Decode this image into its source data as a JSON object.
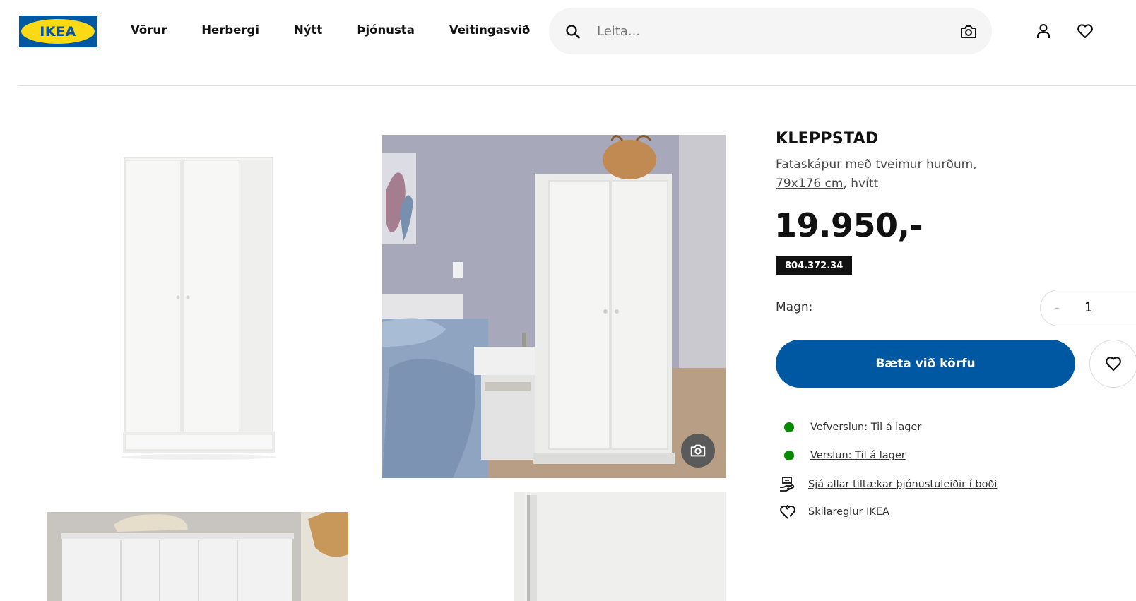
{
  "header": {
    "logo_text": "IKEA",
    "nav": [
      "Vörur",
      "Herbergi",
      "Nýtt",
      "Þjónusta",
      "Veitingasvið"
    ],
    "search_placeholder": "Leita...",
    "icons": [
      "search-icon",
      "camera-icon",
      "user-icon",
      "heart-icon"
    ]
  },
  "product": {
    "name": "KLEPPSTAD",
    "description_line1": "Fataskápur með tveimur hurðum,",
    "measure": "79x176 cm",
    "color_suffix": ", hvítt",
    "price": "19.950,-",
    "article_number": "804.372.34",
    "quantity_label": "Magn:",
    "quantity_minus": "-",
    "quantity_value": "1",
    "add_to_cart": "Bæta við körfu"
  },
  "availability": {
    "online": "Vefverslun: Til á lager",
    "store": "Verslun: Til á lager",
    "services_link": "Sjá allar tiltækar þjónustuleiðir í boði",
    "returns_link": "Skilareglur IKEA",
    "status_color": "#0a8a00"
  },
  "colors": {
    "brand_blue": "#0058a3",
    "brand_yellow": "#fbd914"
  }
}
